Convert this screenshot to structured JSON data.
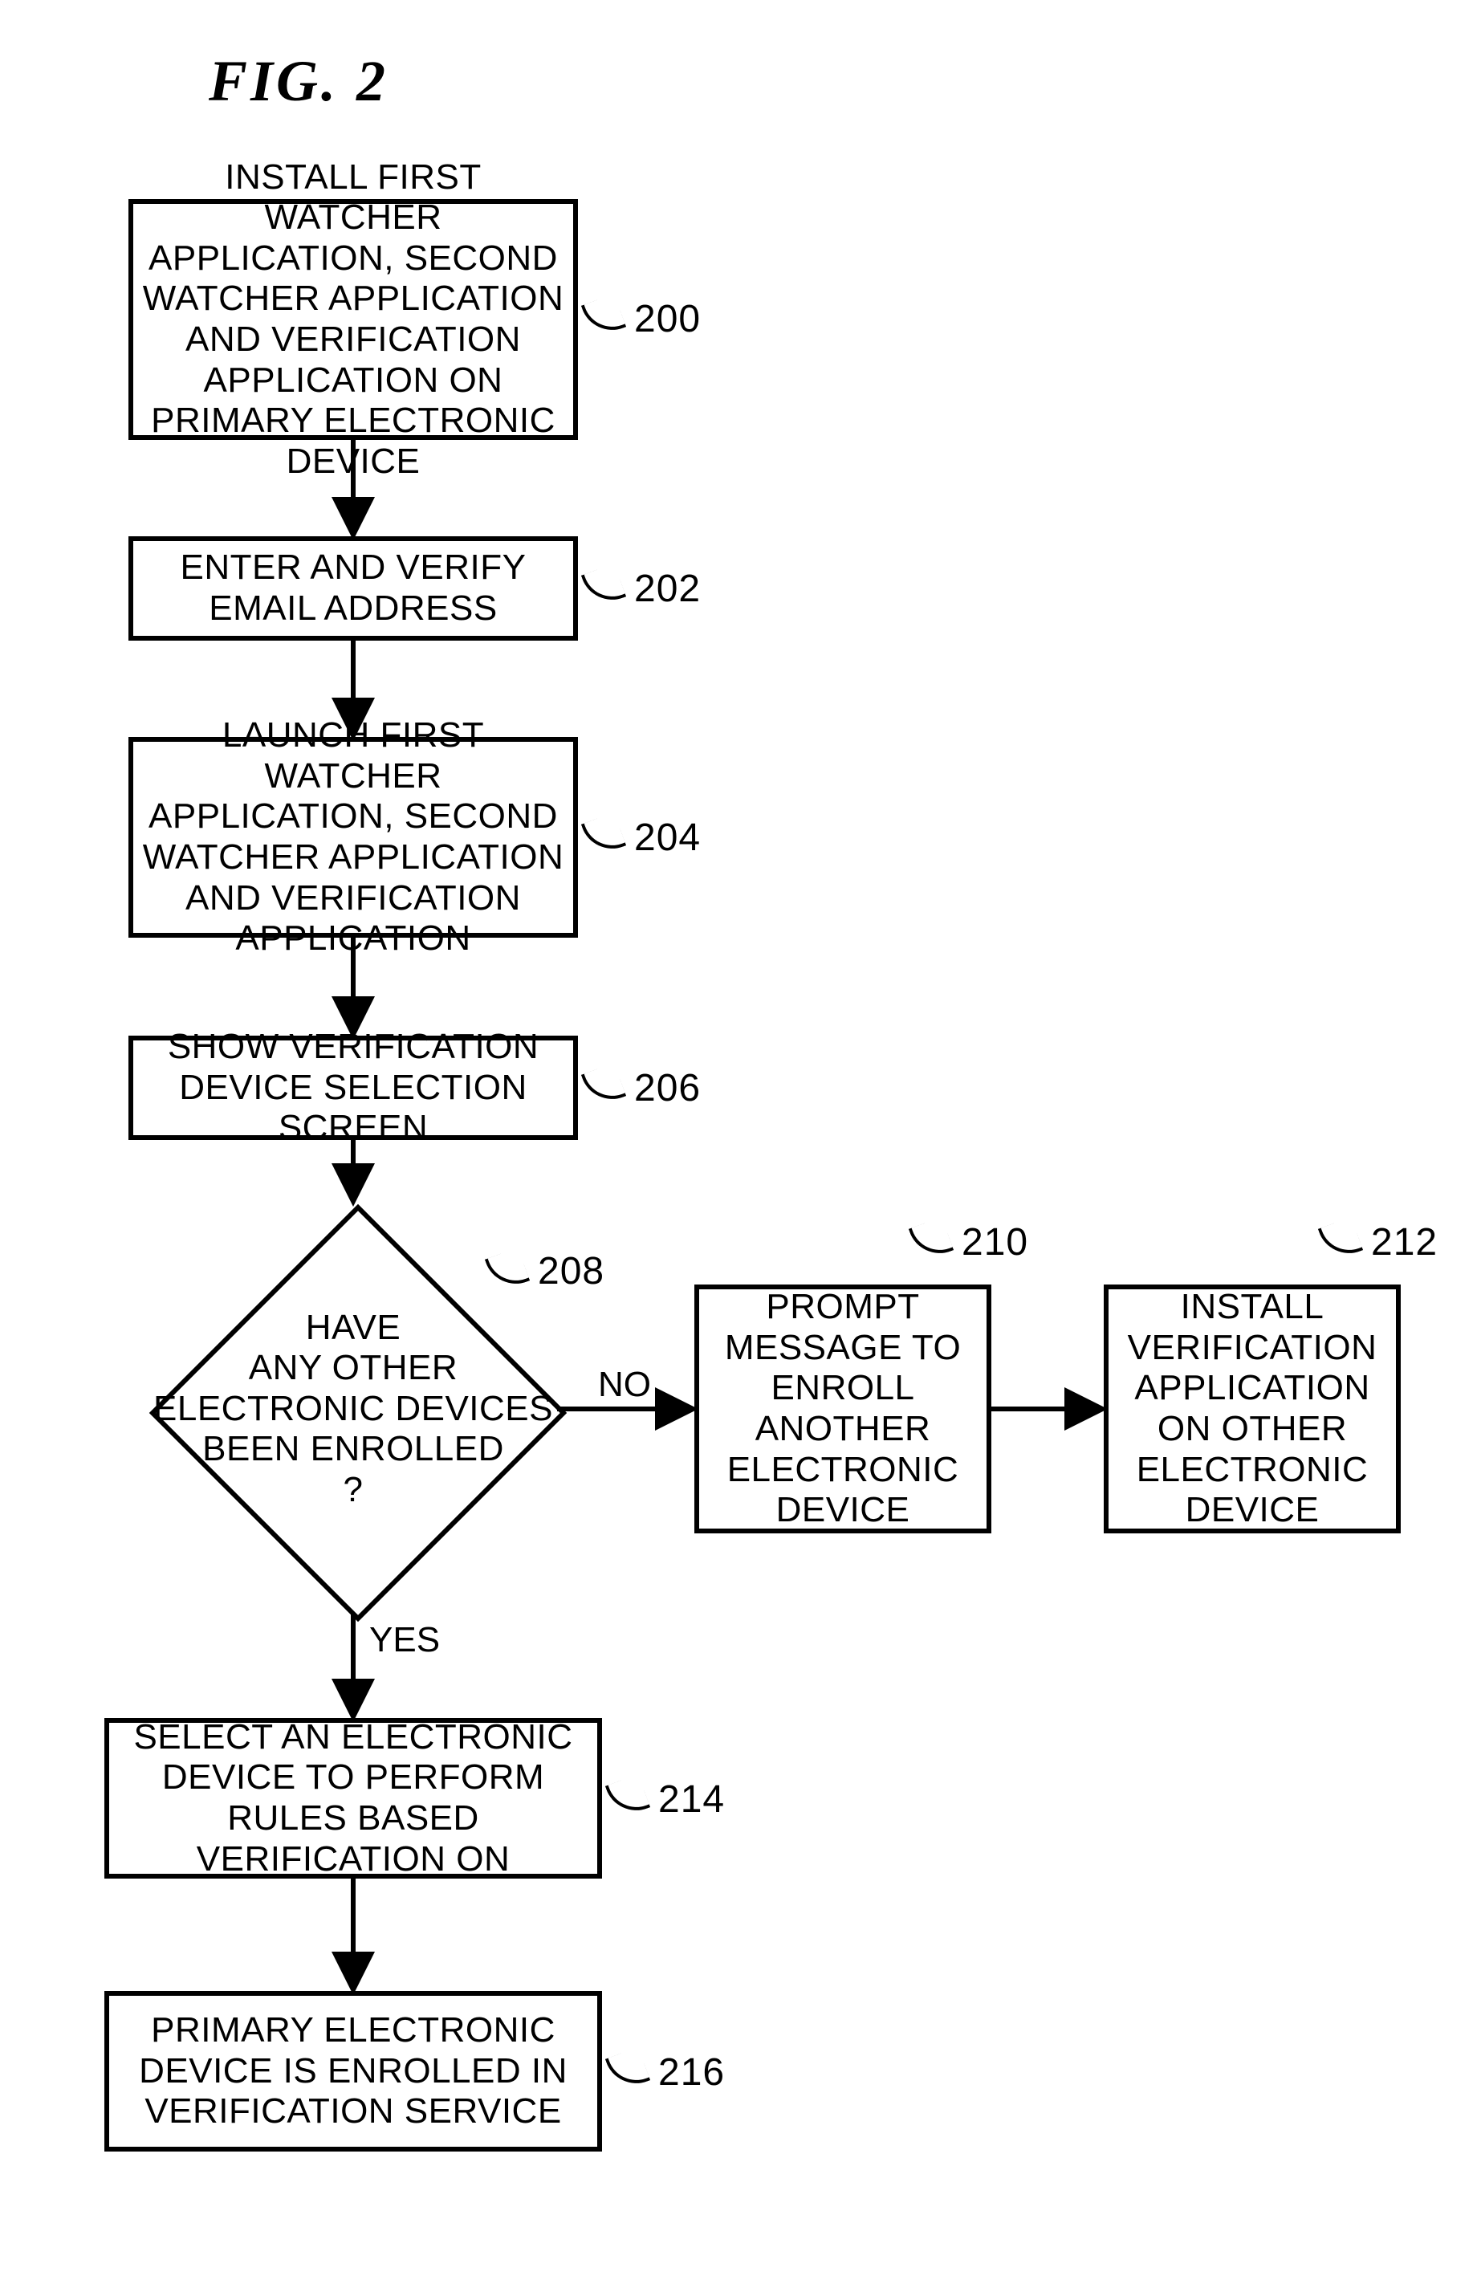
{
  "figure": {
    "title": "FIG.  2"
  },
  "nodes": {
    "n200": {
      "text": "INSTALL FIRST WATCHER APPLICATION, SECOND WATCHER APPLICATION AND VERIFICATION APPLICATION ON PRIMARY ELECTRONIC DEVICE",
      "ref": "200"
    },
    "n202": {
      "text": "ENTER AND VERIFY\nEMAIL ADDRESS",
      "ref": "202"
    },
    "n204": {
      "text": "LAUNCH FIRST WATCHER APPLICATION, SECOND WATCHER APPLICATION AND VERIFICATION APPLICATION",
      "ref": "204"
    },
    "n206": {
      "text": "SHOW VERIFICATION DEVICE SELECTION SCREEN",
      "ref": "206"
    },
    "n208": {
      "text": "HAVE\nANY OTHER\nELECTRONIC DEVICES\nBEEN ENROLLED\n?",
      "ref": "208"
    },
    "n210": {
      "text": "PROMPT MESSAGE TO ENROLL ANOTHER ELECTRONIC DEVICE",
      "ref": "210"
    },
    "n212": {
      "text": "INSTALL VERIFICATION APPLICATION ON OTHER ELECTRONIC DEVICE",
      "ref": "212"
    },
    "n214": {
      "text": "SELECT AN ELECTRONIC DEVICE TO PERFORM RULES BASED VERIFICATION ON",
      "ref": "214"
    },
    "n216": {
      "text": "PRIMARY ELECTRONIC DEVICE IS ENROLLED IN VERIFICATION SERVICE",
      "ref": "216"
    }
  },
  "branches": {
    "no": "NO",
    "yes": "YES"
  }
}
